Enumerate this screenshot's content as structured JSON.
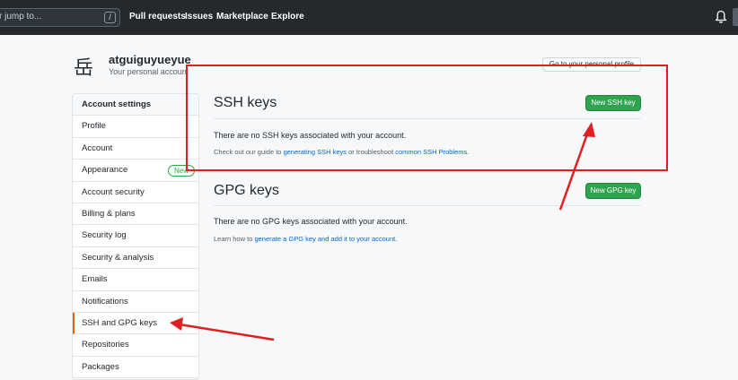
{
  "header": {
    "search_placeholder": "r jump to...",
    "slash_key": "/",
    "nav": [
      "Pull requests",
      "Issues",
      "Marketplace",
      "Explore"
    ]
  },
  "user": {
    "avatar_glyph": "岳",
    "name": "atguiguyueyue",
    "subtitle": "Your personal accoun",
    "go_profile": "Go to your personal profile"
  },
  "sidebar": {
    "heading": "Account settings",
    "items": [
      {
        "label": "Profile"
      },
      {
        "label": "Account"
      },
      {
        "label": "Appearance",
        "badge": "New"
      },
      {
        "label": "Account security"
      },
      {
        "label": "Billing & plans"
      },
      {
        "label": "Security log"
      },
      {
        "label": "Security & analysis"
      },
      {
        "label": "Emails"
      },
      {
        "label": "Notifications"
      },
      {
        "label": "SSH and GPG keys"
      },
      {
        "label": "Repositories"
      },
      {
        "label": "Packages"
      }
    ]
  },
  "ssh": {
    "title": "SSH keys",
    "button": "New SSH key",
    "message": "There are no SSH keys associated with your account.",
    "note_prefix": "Check out our guide to ",
    "note_link1": "generating SSH keys",
    "note_mid": " or troubleshoot ",
    "note_link2": "common SSH Problems",
    "note_suffix": "."
  },
  "gpg": {
    "title": "GPG keys",
    "button": "New GPG key",
    "message": "There are no GPG keys associated with your account.",
    "note_prefix": "Learn how to ",
    "note_link": "generate a GPG key and add it to your account",
    "note_suffix": "."
  },
  "colors": {
    "header_bg": "#24292e",
    "primary_green": "#2ea44f",
    "link_blue": "#0366d6",
    "annotation_red": "#e02020",
    "active_accent": "#e36209"
  }
}
